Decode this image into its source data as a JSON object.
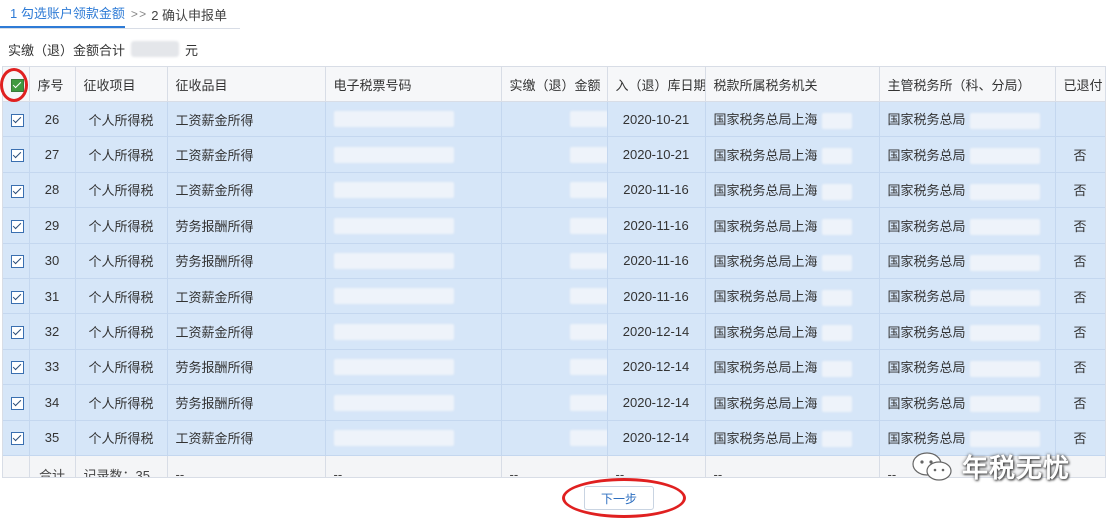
{
  "steps": {
    "step1_label": "1 勾选账户领款金额",
    "separator": "> >",
    "step2_label": "2 确认申报单"
  },
  "summary": {
    "prefix": "实缴（退）金额合计",
    "suffix": "元"
  },
  "table": {
    "headers": [
      "序号",
      "征收项目",
      "征收品目",
      "电子税票号码",
      "实缴（退）金额",
      "入（退）库日期",
      "税款所属税务机关",
      "主管税务所（科、分局）",
      "已退付"
    ],
    "rows": [
      {
        "seq": "26",
        "project": "个人所得税",
        "item": "工资薪金所得",
        "date": "2020-10-21",
        "refunded": ""
      },
      {
        "seq": "27",
        "project": "个人所得税",
        "item": "工资薪金所得",
        "date": "2020-10-21",
        "refunded": "否"
      },
      {
        "seq": "28",
        "project": "个人所得税",
        "item": "工资薪金所得",
        "date": "2020-11-16",
        "refunded": "否"
      },
      {
        "seq": "29",
        "project": "个人所得税",
        "item": "劳务报酬所得",
        "date": "2020-11-16",
        "refunded": "否"
      },
      {
        "seq": "30",
        "project": "个人所得税",
        "item": "劳务报酬所得",
        "date": "2020-11-16",
        "refunded": "否"
      },
      {
        "seq": "31",
        "project": "个人所得税",
        "item": "工资薪金所得",
        "date": "2020-11-16",
        "refunded": "否"
      },
      {
        "seq": "32",
        "project": "个人所得税",
        "item": "工资薪金所得",
        "date": "2020-12-14",
        "refunded": "否"
      },
      {
        "seq": "33",
        "project": "个人所得税",
        "item": "劳务报酬所得",
        "date": "2020-12-14",
        "refunded": "否"
      },
      {
        "seq": "34",
        "project": "个人所得税",
        "item": "劳务报酬所得",
        "date": "2020-12-14",
        "refunded": "否"
      },
      {
        "seq": "35",
        "project": "个人所得税",
        "item": "工资薪金所得",
        "date": "2020-12-14",
        "refunded": "否"
      }
    ],
    "tax_office": "国家税务总局上海",
    "sub_office": "国家税务总局",
    "footer": {
      "label": "合计",
      "count": "记录数：35",
      "dash": "--"
    }
  },
  "buttons": {
    "next": "下一步"
  },
  "watermark": {
    "text": "年税无忧"
  },
  "colors": {
    "selected_row": "#d6e6f8",
    "accent": "#2e7bd6",
    "annotation": "#e02020"
  }
}
